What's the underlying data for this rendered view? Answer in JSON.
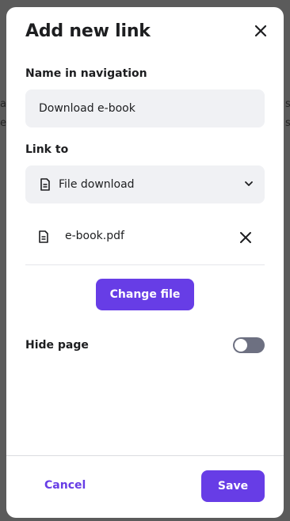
{
  "background": {
    "fragments": [
      "a",
      "e",
      "s",
      "s"
    ]
  },
  "modal": {
    "title": "Add new link",
    "close_icon": "close-icon",
    "name_label": "Name in navigation",
    "name_value": "Download e-book",
    "link_label": "Link to",
    "link_value": "File download",
    "link_icon": "document-icon",
    "file": {
      "name": "e-book.pdf",
      "icon": "document-icon",
      "remove_icon": "close-icon"
    },
    "change_file_label": "Change file",
    "hide_page_label": "Hide page",
    "hide_page_enabled": false
  },
  "footer": {
    "cancel_label": "Cancel",
    "save_label": "Save"
  },
  "colors": {
    "accent": "#673de6",
    "input_bg": "#f0f1f4",
    "toggle_off": "#6d7081",
    "text": "#1d1e20"
  }
}
